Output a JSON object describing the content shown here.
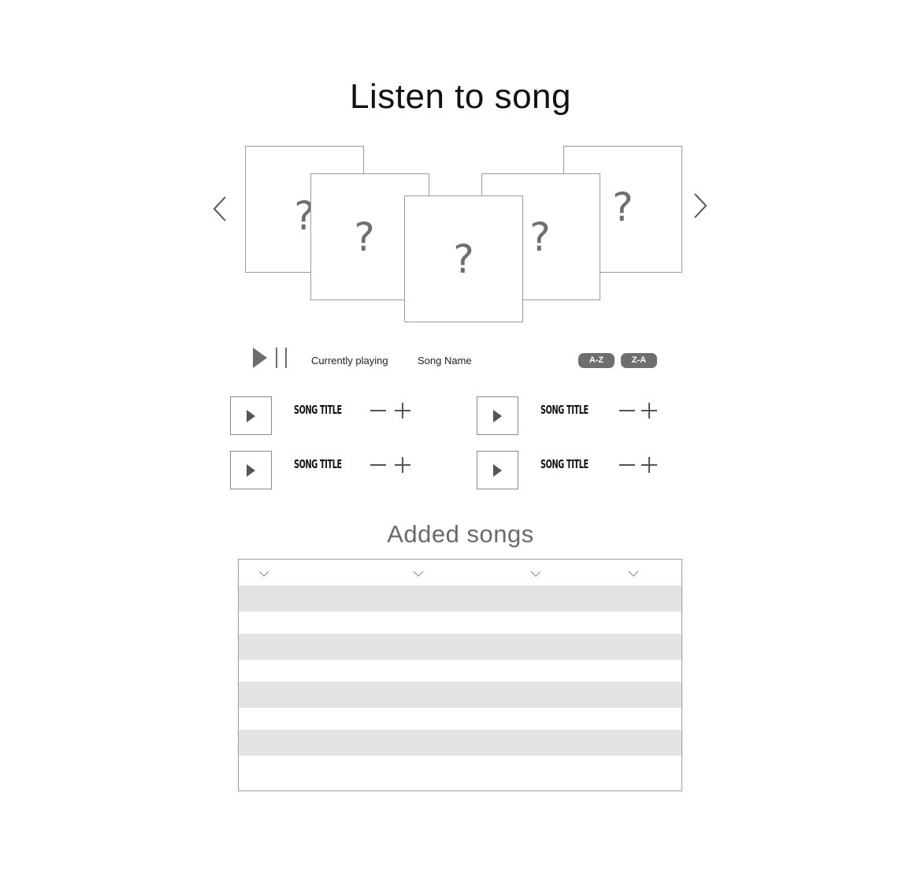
{
  "page": {
    "title": "Listen to song"
  },
  "carousel": {
    "placeholder_glyph": "?",
    "prev_icon": "chevron-left-icon",
    "next_icon": "chevron-right-icon"
  },
  "player": {
    "currently_playing_label": "Currently playing",
    "song_name": "Song Name",
    "sort_az_label": "A-Z",
    "sort_za_label": "Z-A"
  },
  "songs": [
    {
      "title": "SONG TITLE"
    },
    {
      "title": "SONG TITLE"
    },
    {
      "title": "SONG TITLE"
    },
    {
      "title": "SONG TITLE"
    }
  ],
  "added_songs": {
    "title": "Added songs",
    "column_sort_icon": "chevron-down-icon"
  },
  "colors": {
    "stripe": "#e3e3e3",
    "border": "#9a9a9a",
    "button": "#6e6e6e"
  }
}
